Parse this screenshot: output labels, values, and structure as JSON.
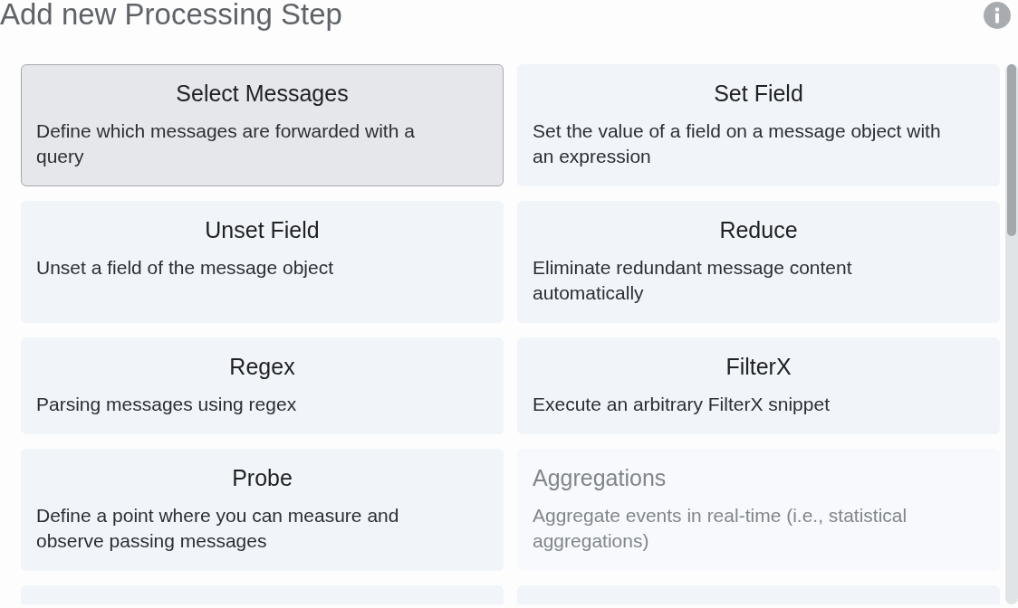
{
  "title": "Add new Processing Step",
  "steps": [
    {
      "kind": "step",
      "name": "Select Messages",
      "description": "Define which messages are forwarded with a query",
      "selected": true,
      "disabled": false
    },
    {
      "kind": "step",
      "name": "Set Field",
      "description": "Set the value of a field on a message object with an expression",
      "selected": false,
      "disabled": false
    },
    {
      "kind": "step",
      "name": "Unset Field",
      "description": "Unset a field of the message object",
      "selected": false,
      "disabled": false
    },
    {
      "kind": "step",
      "name": "Reduce",
      "description": "Eliminate redundant message content automatically",
      "selected": false,
      "disabled": false
    },
    {
      "kind": "step",
      "name": "Regex",
      "description": "Parsing messages using regex",
      "selected": false,
      "disabled": false
    },
    {
      "kind": "step",
      "name": "FilterX",
      "description": "Execute an arbitrary FilterX snippet",
      "selected": false,
      "disabled": false
    },
    {
      "kind": "step",
      "name": "Probe",
      "description": "Define a point where you can measure and observe passing messages",
      "selected": false,
      "disabled": false
    },
    {
      "kind": "step",
      "name": "Aggregations",
      "description": "Aggregate events in real-time (i.e., statistical aggregations)",
      "selected": false,
      "disabled": true
    },
    {
      "kind": "cut_off"
    },
    {
      "kind": "cut_off"
    }
  ]
}
